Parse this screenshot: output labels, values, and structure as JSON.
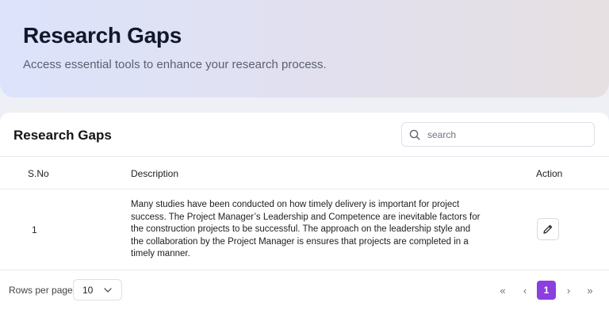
{
  "header": {
    "title": "Research Gaps",
    "subtitle": "Access essential tools to enhance your research process."
  },
  "card": {
    "title": "Research Gaps",
    "search": {
      "placeholder": "search",
      "value": ""
    }
  },
  "table": {
    "columns": [
      "S.No",
      "Description",
      "Action"
    ],
    "rows": [
      {
        "sno": "1",
        "description": "Many studies have been conducted on how timely delivery is important for project success. The Project Manager’s Leadership and Competence are inevitable factors for the construction projects to be successful. The approach on the leadership style and the collaboration by the Project Manager is ensures that projects are completed in a timely manner.",
        "action_icon": "pencil-edit-icon"
      }
    ]
  },
  "footer": {
    "rows_per_page_label": "Rows per page",
    "rows_per_page_value": "10",
    "pagination": {
      "first": "«",
      "prev": "‹",
      "current_page": "1",
      "next": "›",
      "last": "»"
    }
  },
  "colors": {
    "accent": "#8b3fe0",
    "hero_gradient_start": "#dce3fb",
    "hero_gradient_end": "#e6e0e2"
  }
}
